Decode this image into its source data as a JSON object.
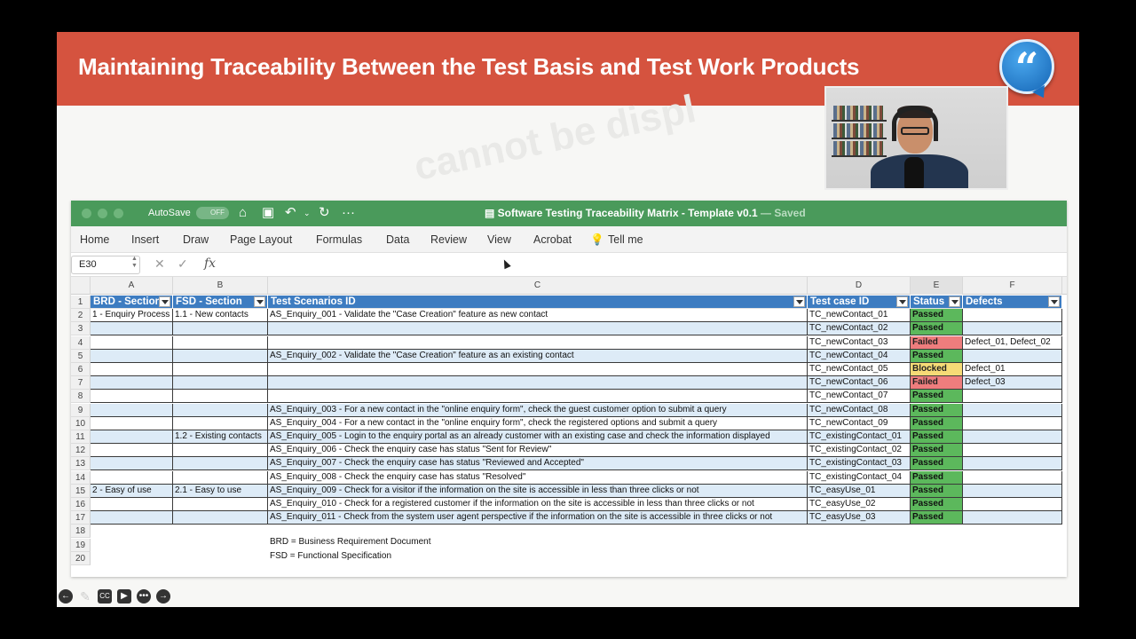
{
  "slide": {
    "title": "Maintaining Traceability Between the Test Basis and Test Work Products",
    "quote_icon": "quote-icon",
    "watermark": "cannot be displ"
  },
  "excel": {
    "autosave_label": "AutoSave",
    "autosave_state": "OFF",
    "doc_title": "Software Testing Traceability Matrix - Template v0.1",
    "doc_saved": "— Saved",
    "tabs": [
      "Home",
      "Insert",
      "Draw",
      "Page Layout",
      "Formulas",
      "Data",
      "Review",
      "View",
      "Acrobat",
      "Tell me"
    ],
    "name_box": "E30",
    "fx": "fx",
    "columns": [
      "A",
      "B",
      "C",
      "D",
      "E",
      "F"
    ],
    "headers": [
      "BRD - Section",
      "FSD - Section",
      "Test Scenarios ID",
      "Test case ID",
      "Status",
      "Defects"
    ],
    "rows": [
      [
        "1 - Enquiry Process",
        "1.1 - New contacts",
        "AS_Enquiry_001 - Validate the \"Case Creation\" feature as new contact",
        "TC_newContact_01",
        "Passed",
        ""
      ],
      [
        "",
        "",
        "",
        "TC_newContact_02",
        "Passed",
        ""
      ],
      [
        "",
        "",
        "",
        "TC_newContact_03",
        "Failed",
        "Defect_01, Defect_02"
      ],
      [
        "",
        "",
        "AS_Enquiry_002 - Validate the \"Case Creation\" feature as an existing contact",
        "TC_newContact_04",
        "Passed",
        ""
      ],
      [
        "",
        "",
        "",
        "TC_newContact_05",
        "Blocked",
        "Defect_01"
      ],
      [
        "",
        "",
        "",
        "TC_newContact_06",
        "Failed",
        "Defect_03"
      ],
      [
        "",
        "",
        "",
        "TC_newContact_07",
        "Passed",
        ""
      ],
      [
        "",
        "",
        "AS_Enquiry_003 - For a new contact in the \"online enquiry form\", check the guest customer option to submit a query",
        "TC_newContact_08",
        "Passed",
        ""
      ],
      [
        "",
        "",
        "AS_Enquiry_004 - For a new contact in the \"online enquiry form\", check the registered options and submit a query",
        "TC_newContact_09",
        "Passed",
        ""
      ],
      [
        "",
        "1.2 - Existing contacts",
        "AS_Enquiry_005 - Login to the enquiry portal as an already customer with an existing case and check the information displayed",
        "TC_existingContact_01",
        "Passed",
        ""
      ],
      [
        "",
        "",
        "AS_Enquiry_006 - Check the enquiry case has status \"Sent for Review\"",
        "TC_existingContact_02",
        "Passed",
        ""
      ],
      [
        "",
        "",
        "AS_Enquiry_007 - Check the enquiry case has status \"Reviewed and Accepted\"",
        "TC_existingContact_03",
        "Passed",
        ""
      ],
      [
        "",
        "",
        "AS_Enquiry_008 - Check the enquiry case has status \"Resolved\"",
        "TC_existingContact_04",
        "Passed",
        ""
      ],
      [
        "2 - Easy of use",
        "2.1 - Easy to use",
        "AS_Enquiry_009 - Check for a visitor if the information on the site is accessible in less than three clicks or not",
        "TC_easyUse_01",
        "Passed",
        ""
      ],
      [
        "",
        "",
        "AS_Enquiry_010 - Check for a registered customer if the information on the site is accessible in less than three clicks or not",
        "TC_easyUse_02",
        "Passed",
        ""
      ],
      [
        "",
        "",
        "AS_Enquiry_011 - Check from the system user agent perspective if the information on the site is accessible in three clicks or not",
        "TC_easyUse_03",
        "Passed",
        ""
      ]
    ],
    "row_numbers": [
      "1",
      "2",
      "3",
      "4",
      "5",
      "6",
      "7",
      "8",
      "9",
      "10",
      "11",
      "12",
      "13",
      "14",
      "15",
      "16",
      "17",
      "18",
      "19",
      "20"
    ],
    "notes": [
      "BRD = Business Requirement Document",
      "FSD = Functional Specification"
    ]
  },
  "colors": {
    "title_bar": "#d5533f",
    "excel_green": "#4a9a5b",
    "header_blue": "#3d7cc1",
    "passed": "#5cb85c",
    "failed": "#ee7d7d",
    "blocked": "#f6db76"
  },
  "controls": [
    "back-icon",
    "pen-icon",
    "captions-icon",
    "video-off-icon",
    "more-icon",
    "forward-icon"
  ]
}
